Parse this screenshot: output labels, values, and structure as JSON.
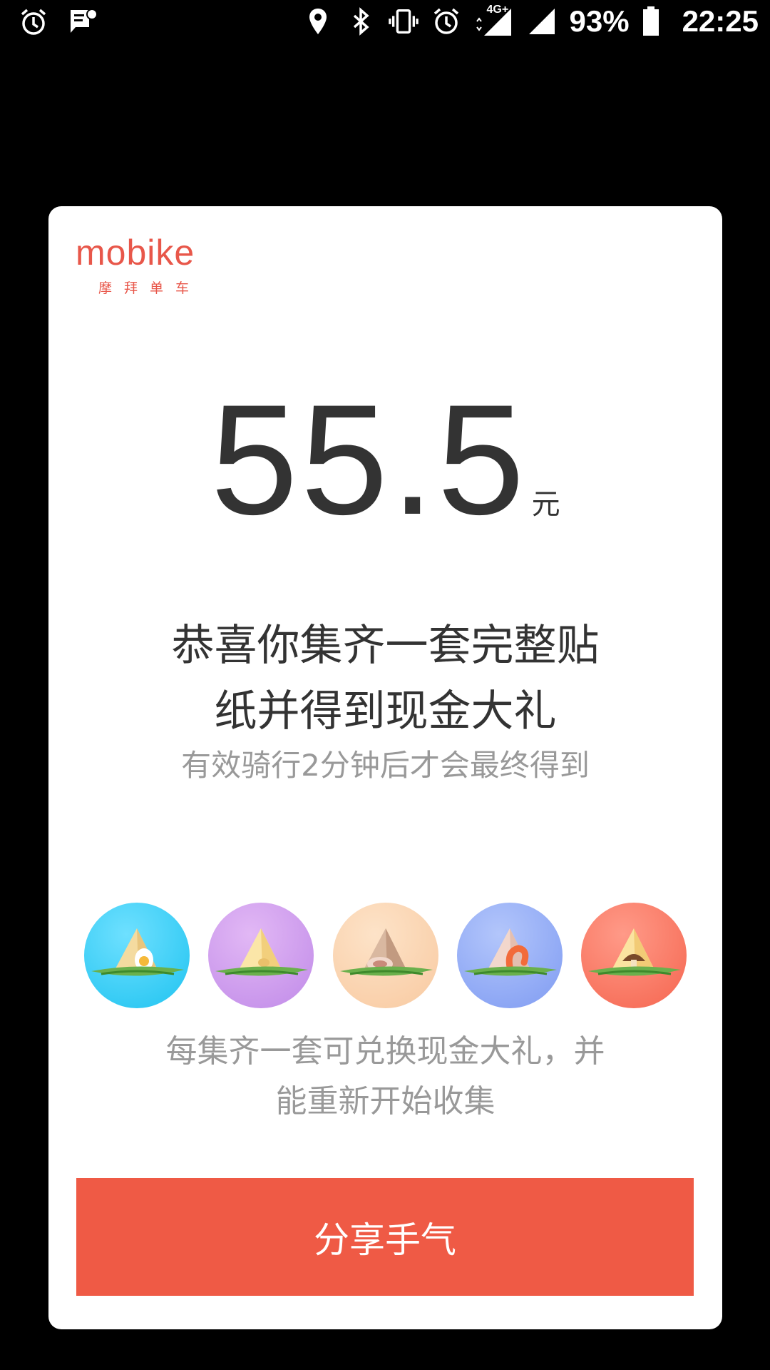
{
  "status_bar": {
    "battery_percent": "93%",
    "time": "22:25",
    "network": "4G+",
    "icons": [
      "alarm-icon",
      "message-icon",
      "location-icon",
      "bluetooth-icon",
      "vibrate-icon",
      "alarm-icon",
      "signal-4g-icon",
      "signal-icon",
      "battery-icon"
    ]
  },
  "card": {
    "logo": {
      "wordmark": "mobike",
      "subtitle": "摩拜单车",
      "color": "#e8574a"
    },
    "amount": {
      "value": "55.5",
      "unit": "元"
    },
    "congrats_line1": "恭喜你集齐一套完整贴",
    "congrats_line2": "纸并得到现金大礼",
    "hint": "有效骑行2分钟后才会最终得到",
    "stickers": [
      {
        "name": "egg-zongzi",
        "color": "#3cc9ef"
      },
      {
        "name": "sweet-zongzi",
        "color": "#c79be9"
      },
      {
        "name": "meat-zongzi",
        "color": "#fbd6b5"
      },
      {
        "name": "shrimp-zongzi",
        "color": "#8fa9f5"
      },
      {
        "name": "mushroom-zongzi",
        "color": "#f97565"
      }
    ],
    "description_line1": "每集齐一套可兑换现金大礼，并",
    "description_line2": "能重新开始收集",
    "share_button": "分享手气",
    "accent_color": "#ef5a45"
  }
}
